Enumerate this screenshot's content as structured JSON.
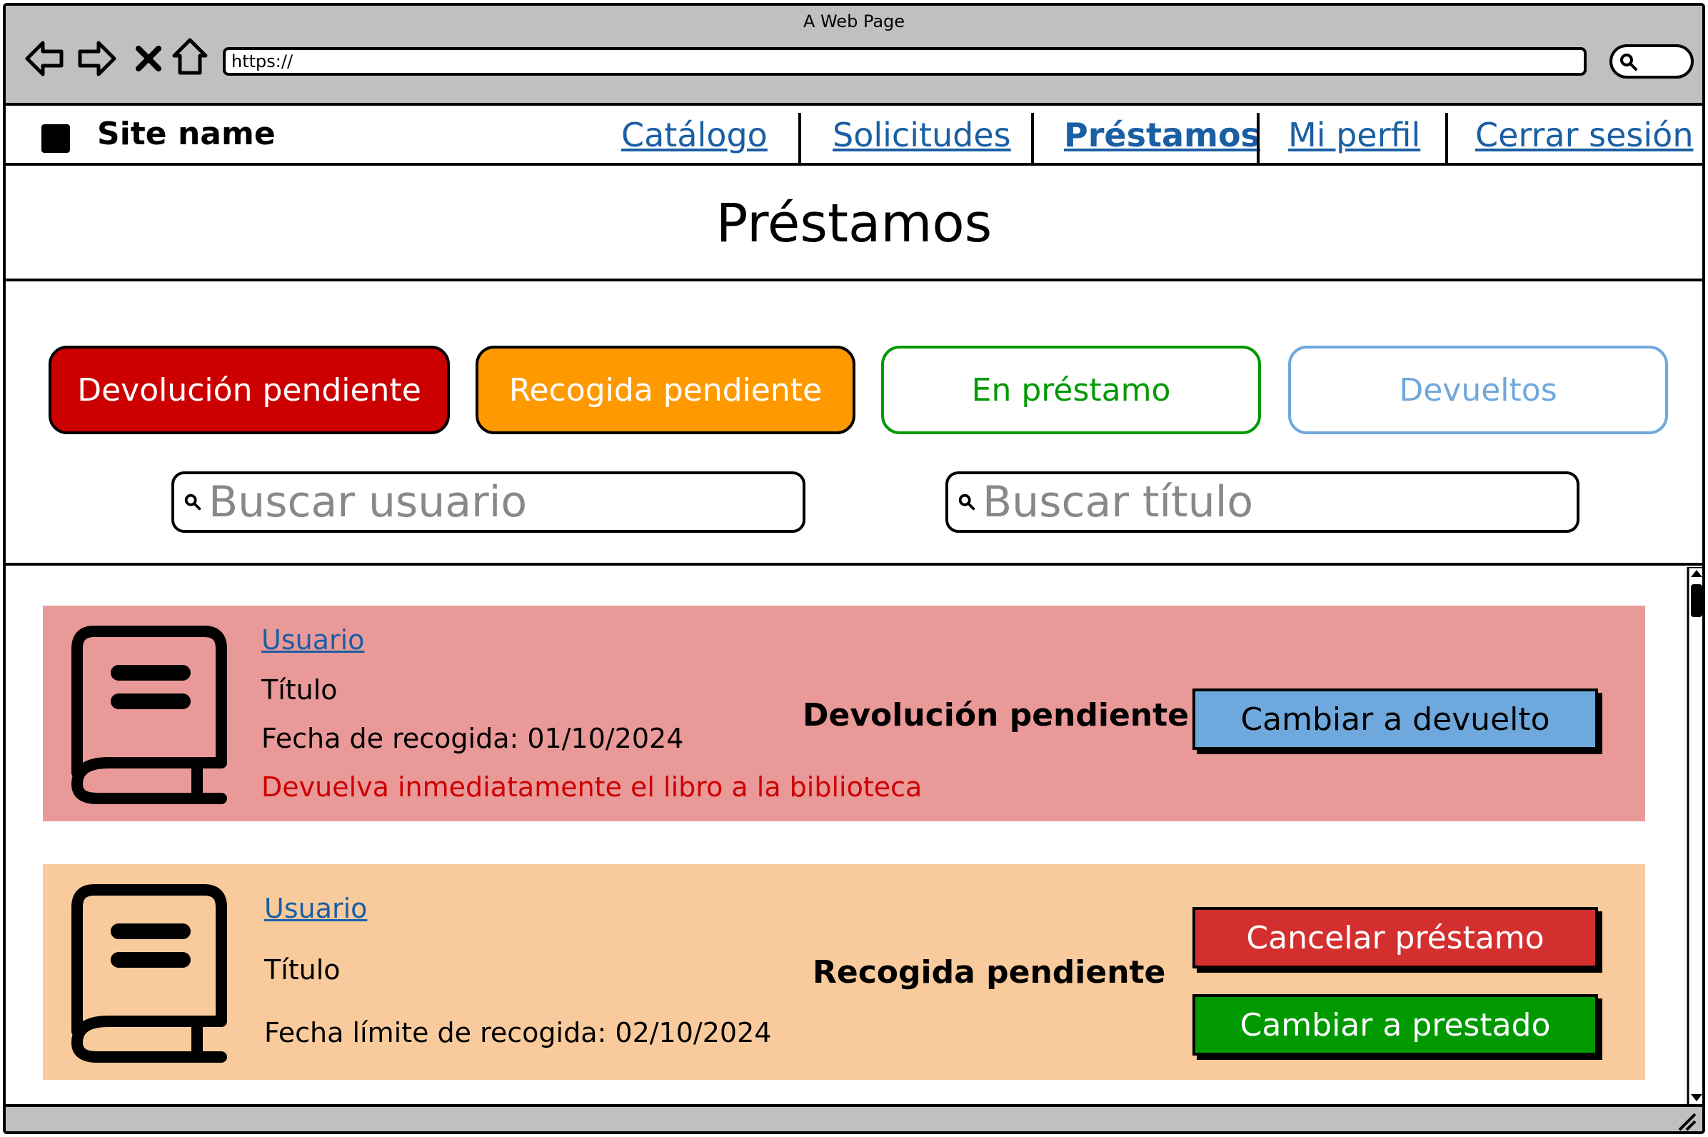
{
  "window": {
    "title": "A Web Page",
    "url": "https://"
  },
  "site": {
    "name": "Site name"
  },
  "nav": [
    {
      "label": "Catálogo"
    },
    {
      "label": "Solicitudes"
    },
    {
      "label": "Préstamos"
    },
    {
      "label": "Mi perfil"
    },
    {
      "label": "Cerrar sesión"
    }
  ],
  "page": {
    "title": "Préstamos"
  },
  "filters": [
    {
      "label": "Devolución pendiente",
      "bg": "#cc0000",
      "fg": "#ffffff"
    },
    {
      "label": "Recogida pendiente",
      "bg": "#ff9900",
      "fg": "#ffffff"
    },
    {
      "label": "En préstamo",
      "bg": "#ffffff",
      "fg": "#009900"
    },
    {
      "label": "Devueltos",
      "bg": "#ffffff",
      "fg": "#6fa8dc"
    }
  ],
  "search": {
    "user_placeholder": "Buscar usuario",
    "title_placeholder": "Buscar título"
  },
  "loans": [
    {
      "user": "Usuario",
      "title": "Título",
      "date": "Fecha de recogida: 01/10/2024",
      "warning": "Devuelva inmediatamente el libro a la biblioteca",
      "status": "Devolución pendiente",
      "bg": "#ea9999",
      "actions": [
        {
          "label": "Cambiar a devuelto",
          "bg": "#6fa8dc",
          "fg": "#000000"
        }
      ]
    },
    {
      "user": "Usuario",
      "title": "Título",
      "date": "Fecha límite de recogida: 02/10/2024",
      "status": "Recogida pendiente",
      "bg": "#f9cb9c",
      "actions": [
        {
          "label": "Cancelar préstamo",
          "bg": "#d32f2f",
          "fg": "#ffffff"
        },
        {
          "label": "Cambiar a prestado",
          "bg": "#009900",
          "fg": "#ffffff"
        }
      ]
    }
  ],
  "icons": {
    "back": "arrow-left-icon",
    "forward": "arrow-right-icon",
    "stop": "close-icon",
    "home": "home-icon",
    "search": "search-icon",
    "book": "book-icon"
  }
}
